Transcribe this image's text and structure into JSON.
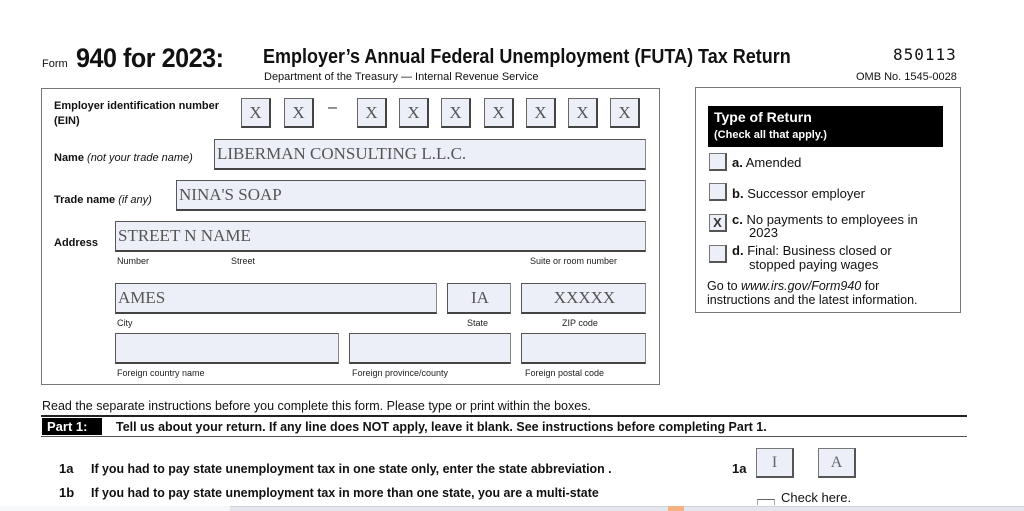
{
  "header": {
    "form_word": "Form",
    "form_number": "940 for 2023:",
    "title": "Employer’s Annual Federal Unemployment (FUTA) Tax Return",
    "department": "Department of the Treasury — Internal Revenue Service",
    "form_code": "850113",
    "omb": "OMB No. 1545-0028"
  },
  "employer": {
    "ein_label": "Employer identification number",
    "ein_label2": "(EIN)",
    "ein_digits": [
      "X",
      "X",
      "X",
      "X",
      "X",
      "X",
      "X",
      "X",
      "X"
    ],
    "ein_separator": "–",
    "name_label": "Name",
    "name_hint": "(not your trade name)",
    "name_value": "LIBERMAN CONSULTING L.L.C.",
    "trade_label": "Trade name",
    "trade_hint": "(if any)",
    "trade_value": "NINA'S SOAP",
    "address_label": "Address",
    "street_value": "STREET N NAME",
    "number_label": "Number",
    "street_label": "Street",
    "suite_label": "Suite or room number",
    "city_value": "AMES",
    "city_label": "City",
    "state_value": "IA",
    "state_label": "State",
    "zip_value": "XXXXX",
    "zip_label": "ZIP code",
    "foreign_country_value": "",
    "foreign_country_label": "Foreign country name",
    "foreign_province_value": "",
    "foreign_province_label": "Foreign province/county",
    "foreign_postal_value": "",
    "foreign_postal_label": "Foreign postal code"
  },
  "type_of_return": {
    "title": "Type of Return",
    "subtitle": "(Check all that apply.)",
    "options": [
      {
        "letter": "a.",
        "text": "Amended",
        "text2": "",
        "checked": false,
        "mark": ""
      },
      {
        "letter": "b.",
        "text": "Successor employer",
        "text2": "",
        "checked": false,
        "mark": ""
      },
      {
        "letter": "c.",
        "text": "No payments to employees in",
        "text2": "2023",
        "checked": true,
        "mark": "X"
      },
      {
        "letter": "d.",
        "text": "Final: Business closed or",
        "text2": "stopped paying wages",
        "checked": false,
        "mark": ""
      }
    ],
    "go_to_prefix": "Go to ",
    "go_to_link": "www.irs.gov/Form940",
    "go_to_suffix": " for",
    "go_to_line2": "instructions and the latest information."
  },
  "instructions": "Read the separate instructions before you complete this form. Please type or print within the boxes.",
  "part1": {
    "badge": "Part 1:",
    "heading": "Tell us about your return. If any line does NOT apply, leave it blank. See instructions before completing Part 1.",
    "lines": [
      {
        "num": "1a",
        "text": "If you had to pay state unemployment tax in one state only, enter the state abbreviation .",
        "ref": "1a",
        "values": [
          "I",
          "A"
        ]
      },
      {
        "num": "1b",
        "text": "If you had to pay state unemployment tax in more than one state, you are a multi-state",
        "check_label": "Check here."
      }
    ]
  }
}
